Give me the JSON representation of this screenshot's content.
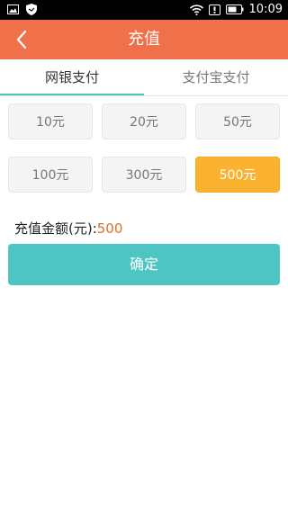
{
  "statusbar": {
    "time": "10:09",
    "icons": [
      "image-icon",
      "shield-icon",
      "wifi-icon",
      "notification-icon",
      "battery-icon"
    ]
  },
  "appbar": {
    "title": "充值",
    "back_icon": "chevron-left-icon",
    "color": "#f0704a"
  },
  "tabs": [
    {
      "label": "网银支付",
      "active": true
    },
    {
      "label": "支付宝支付",
      "active": false
    }
  ],
  "amount_options": [
    {
      "label": "10元",
      "selected": false
    },
    {
      "label": "20元",
      "selected": false
    },
    {
      "label": "50元",
      "selected": false
    },
    {
      "label": "100元",
      "selected": false
    },
    {
      "label": "300元",
      "selected": false
    },
    {
      "label": "500元",
      "selected": true
    }
  ],
  "amount_summary": {
    "label": "充值金额(元):",
    "value": "500"
  },
  "confirm_button": {
    "label": "确定",
    "color": "#4dc5c2"
  },
  "colors": {
    "selected_amount": "#fbb230",
    "tab_indicator": "#4bc6c4"
  }
}
